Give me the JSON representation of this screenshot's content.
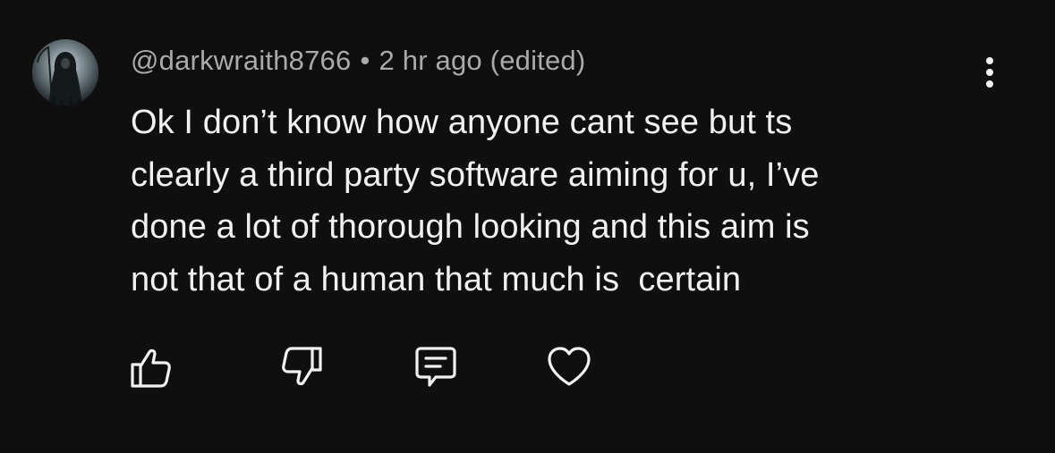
{
  "comment": {
    "author": "@darkwraith8766",
    "separator": "•",
    "timestamp": "2 hr ago (edited)",
    "text": "Ok I don’t know how anyone cant see but ts\nclearly a third party software aiming for u, I’ve\ndone a lot of thorough looking and this aim is\nnot that of a human that much is  certain"
  },
  "icons": {
    "avatar": "grim-reaper-avatar",
    "more": "more-vertical-icon",
    "like": "thumbs-up-icon",
    "dislike": "thumbs-down-icon",
    "reply": "comment-reply-icon",
    "heart": "heart-icon"
  },
  "colors": {
    "background": "#0f0f0f",
    "text": "#f1f1f1",
    "meta": "#aaaaaa"
  }
}
